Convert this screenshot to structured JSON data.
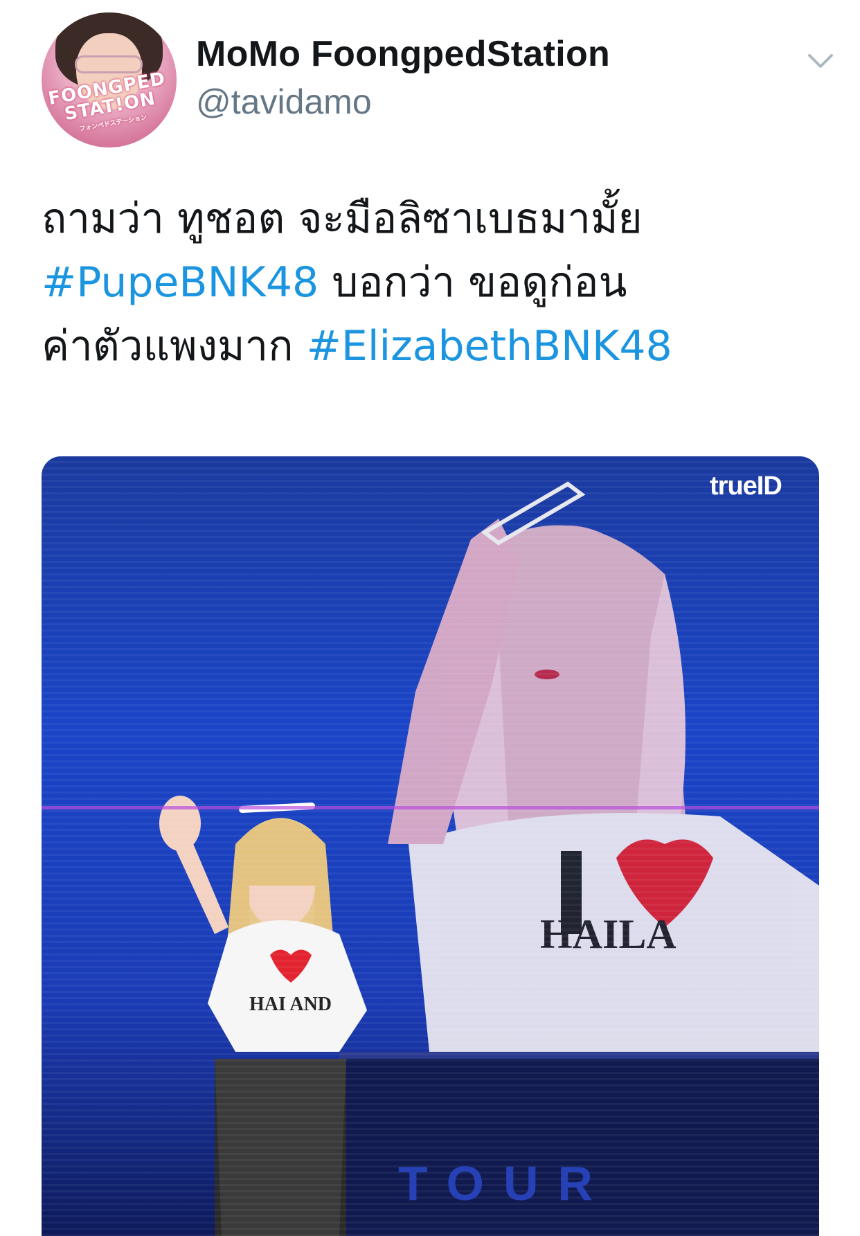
{
  "header": {
    "display_name": "MoMo FoongpedStation",
    "handle": "@tavidamo",
    "avatar_logo": [
      "FOONGPED",
      "STAT!ON",
      "フォンペドステーション"
    ],
    "menu_icon": "chevron-down-icon"
  },
  "tweet": {
    "line1": "ถามว่า ทูชอต จะมือลิซาเบธมามั้ย",
    "hashtag1": "#PupeBNK48",
    "line2_rest": " บอกว่า ขอดูก่อน",
    "line3_start": "ค่าตัวแพงมาก ",
    "hashtag2": "#ElizabethBNK48"
  },
  "media": {
    "watermark": "trueID",
    "stage_text": "TOUR"
  },
  "colors": {
    "link": "#1b95e0",
    "text": "#14171a",
    "secondary": "#657786"
  }
}
